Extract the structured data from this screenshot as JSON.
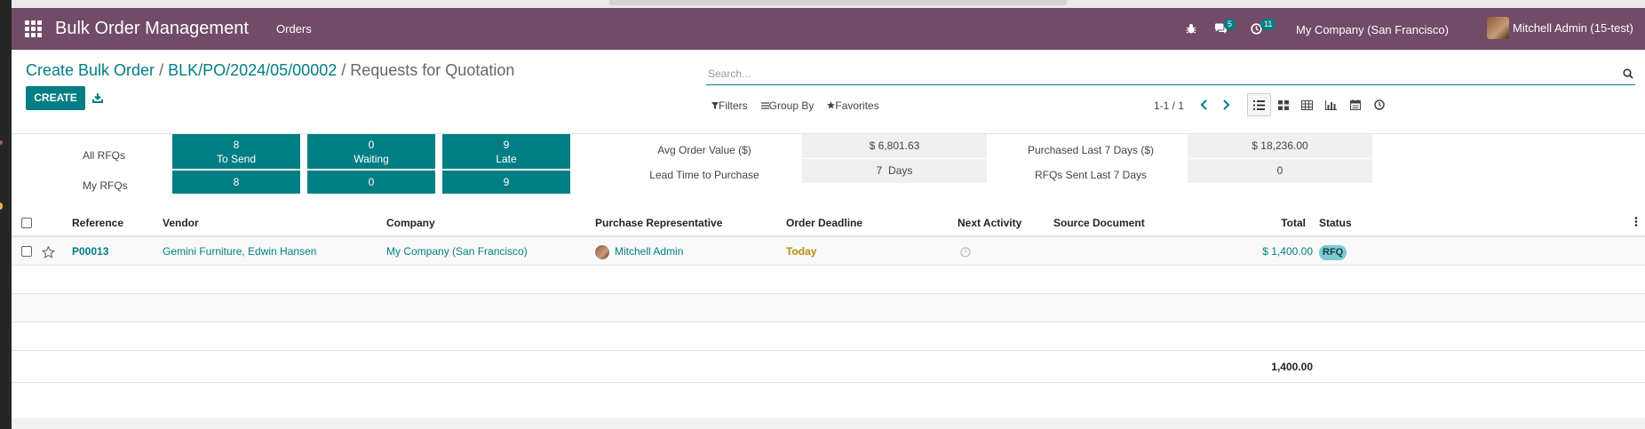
{
  "navbar": {
    "brand": "Bulk Order Management",
    "menu_orders": "Orders",
    "chat_badge": "5",
    "activity_badge": "11",
    "company": "My Company (San Francisco)",
    "user": "Mitchell Admin (15-test)"
  },
  "breadcrumb": {
    "item1": "Create Bulk Order",
    "sep1": " / ",
    "item2": "BLK/PO/2024/05/00002",
    "sep2": " / ",
    "current": "Requests for Quotation"
  },
  "toolbar": {
    "create_label": "CREATE",
    "search_placeholder": "Search...",
    "filters_label": "Filters",
    "groupby_label": "Group By",
    "favorites_label": "Favorites",
    "pager_text": "1-1 / 1"
  },
  "dashboard": {
    "all_rfqs_label": "All RFQs",
    "my_rfqs_label": "My RFQs",
    "tiles_all": [
      {
        "value": "8",
        "label": "To Send"
      },
      {
        "value": "0",
        "label": "Waiting"
      },
      {
        "value": "9",
        "label": "Late"
      }
    ],
    "tiles_my": [
      "8",
      "0",
      "9"
    ],
    "avg_order_label": "Avg Order Value ($)",
    "avg_order_value": "$ 6,801.63",
    "lead_time_label": "Lead Time to Purchase",
    "lead_time_value": "7  Days",
    "purchased_label": "Purchased Last 7 Days ($)",
    "purchased_value": "$ 18,236.00",
    "rfqs_sent_label": "RFQs Sent Last 7 Days",
    "rfqs_sent_value": "0"
  },
  "table": {
    "headers": {
      "reference": "Reference",
      "vendor": "Vendor",
      "company": "Company",
      "rep": "Purchase Representative",
      "deadline": "Order Deadline",
      "activity": "Next Activity",
      "source": "Source Document",
      "total": "Total",
      "status": "Status"
    },
    "rows": [
      {
        "reference": "P00013",
        "vendor": "Gemini Furniture, Edwin Hansen",
        "company": "My Company (San Francisco)",
        "rep": "Mitchell Admin",
        "deadline": "Today",
        "source": "",
        "total": "$ 1,400.00",
        "status": "RFQ"
      }
    ],
    "footer_total": "1,400.00"
  },
  "colors": {
    "navbar": "#714b67",
    "primary": "#017e84",
    "deadline_today": "#b78d0c",
    "rfq_badge": "#7bcbd3"
  }
}
